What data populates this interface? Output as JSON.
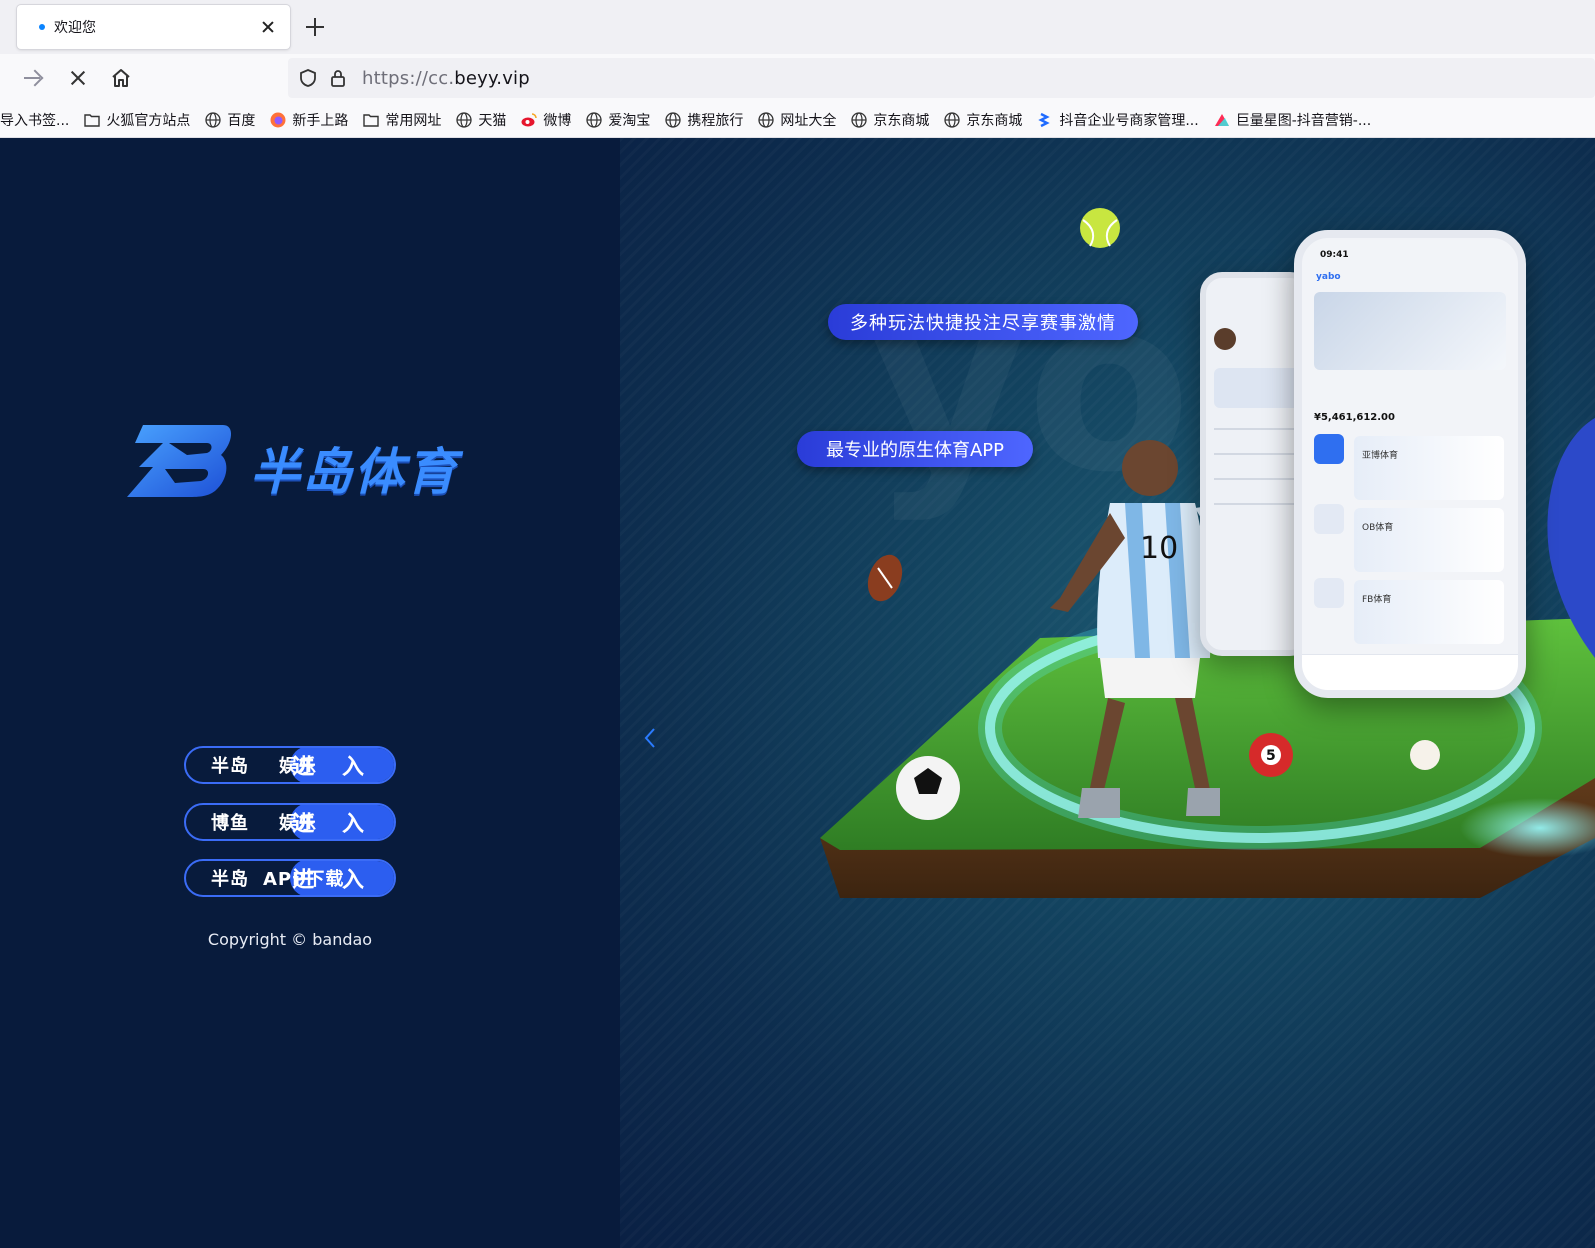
{
  "browser": {
    "tab_title": "欢迎您",
    "url_scheme": "https://cc.",
    "url_domain": "beyy.vip",
    "bookmarks": [
      {
        "label": "导入书签...",
        "icon": "none"
      },
      {
        "label": "火狐官方站点",
        "icon": "folder-icon"
      },
      {
        "label": "百度",
        "icon": "globe-icon"
      },
      {
        "label": "新手上路",
        "icon": "firefox-icon"
      },
      {
        "label": "常用网址",
        "icon": "folder-icon"
      },
      {
        "label": "天猫",
        "icon": "globe-icon"
      },
      {
        "label": "微博",
        "icon": "weibo-icon"
      },
      {
        "label": "爱淘宝",
        "icon": "globe-icon"
      },
      {
        "label": "携程旅行",
        "icon": "globe-icon"
      },
      {
        "label": "网址大全",
        "icon": "globe-icon"
      },
      {
        "label": "京东商城",
        "icon": "globe-icon"
      },
      {
        "label": "京东商城",
        "icon": "globe-icon"
      },
      {
        "label": "抖音企业号商家管理...",
        "icon": "douyin-icon"
      },
      {
        "label": "巨量星图-抖音营销-...",
        "icon": "xingtu-icon"
      }
    ]
  },
  "page": {
    "brand_name": "半岛体育",
    "buttons": [
      {
        "label": "半岛",
        "sub": "娱乐",
        "action": "进 入"
      },
      {
        "label": "博鱼",
        "sub": "娱乐",
        "action": "进 入"
      },
      {
        "label": "半岛",
        "sub": "APP下载",
        "action": "进 入"
      }
    ],
    "copyright": "Copyright © bandao",
    "banner_top": "多种玩法快捷投注尽享赛事激情",
    "banner_bottom": "最专业的原生体育APP",
    "phone": {
      "time": "09:41",
      "brand": "yabo",
      "balance": "¥5,461,612.00",
      "cards": [
        "亚博体育",
        "OB体育",
        "FB体育"
      ]
    }
  },
  "colors": {
    "left_bg": "#081b3c",
    "accent": "#2c5ef0",
    "banner": "#3b4ef0"
  }
}
